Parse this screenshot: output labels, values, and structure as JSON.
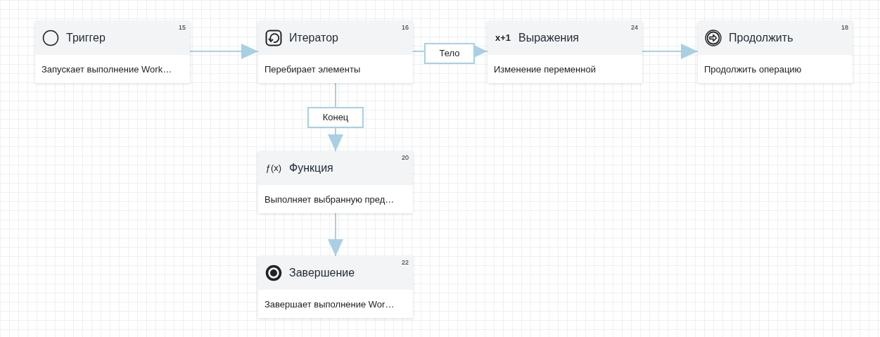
{
  "nodes": [
    {
      "kind": "start",
      "title": "Триггер",
      "number": "15",
      "description": "Запускает выполнение Work…"
    },
    {
      "kind": "iterator",
      "title": "Итератор",
      "number": "16",
      "description": "Перебирает элементы"
    },
    {
      "kind": "expression",
      "icon_text": "x+1",
      "title": "Выражения",
      "number": "24",
      "description": "Изменение переменной"
    },
    {
      "kind": "continue",
      "title": "Продолжить",
      "number": "18",
      "description": "Продолжить операцию"
    },
    {
      "kind": "function",
      "icon_text": "ƒ(x)",
      "title": "Функция",
      "number": "20",
      "description": "Выполняет выбранную пред…"
    },
    {
      "kind": "end",
      "title": "Завершение",
      "number": "22",
      "description": "Завершает выполнение Wor…"
    }
  ],
  "connector_labels": [
    "Тело",
    "Конец"
  ]
}
